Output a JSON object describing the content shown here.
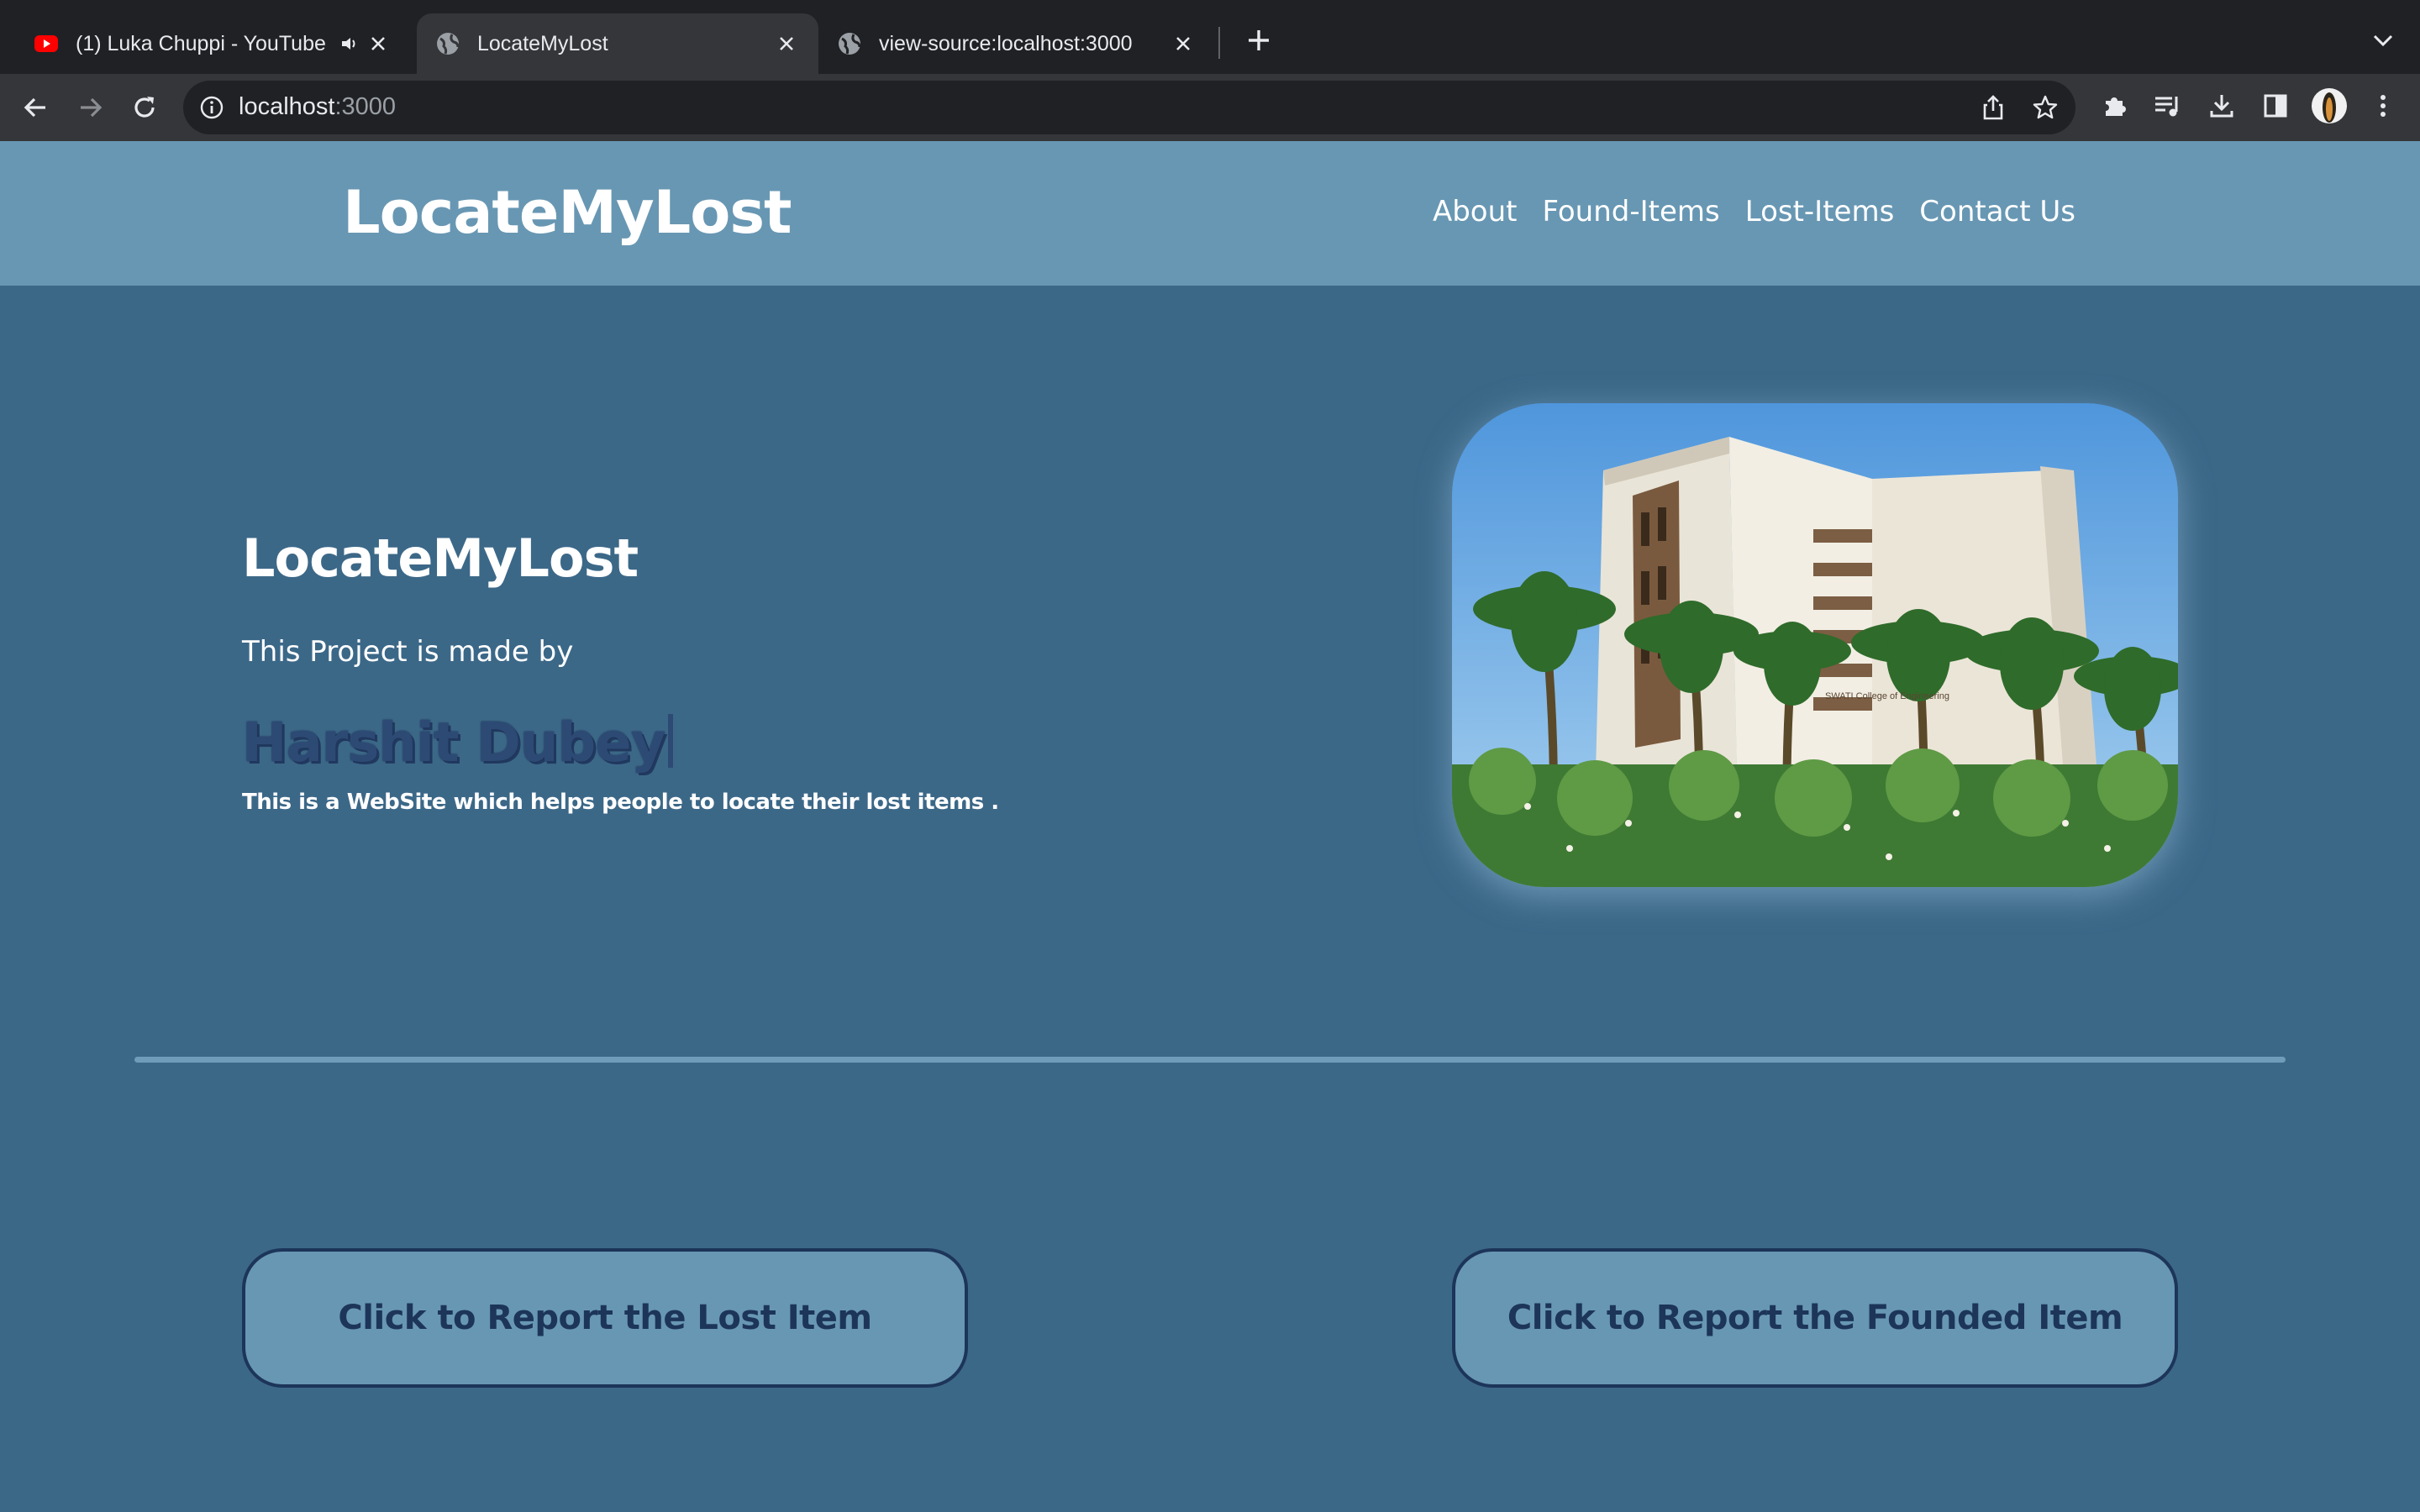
{
  "browser": {
    "tabs": [
      {
        "title": "(1) Luka Chuppi - YouTube",
        "icon": "youtube-icon",
        "audio_icon": "speaker-icon",
        "active": false
      },
      {
        "title": "LocateMyLost",
        "icon": "globe-icon",
        "active": true
      },
      {
        "title": "view-source:localhost:3000",
        "icon": "globe-icon",
        "active": false
      }
    ],
    "address": {
      "host": "localhost",
      "port": ":3000"
    }
  },
  "navbar": {
    "brand": "LocateMyLost",
    "links": [
      "About",
      "Found-Items",
      "Lost-Items",
      "Contact Us"
    ]
  },
  "hero": {
    "title": "LocateMyLost",
    "subtitle": "This Project is made by",
    "name": "Harshit Dubey",
    "description": "This is a WebSite which helps people to locate their lost items .",
    "image_sign": "SWATI College of Engineering"
  },
  "actions": {
    "lost_button": "Click to Report the Lost Item",
    "found_button": "Click to Report the Founded Item"
  },
  "colors": {
    "page_bg": "#3c6888",
    "navbar_bg": "#6897b3",
    "button_text": "#1c3559",
    "name_text": "#2d4a75"
  }
}
